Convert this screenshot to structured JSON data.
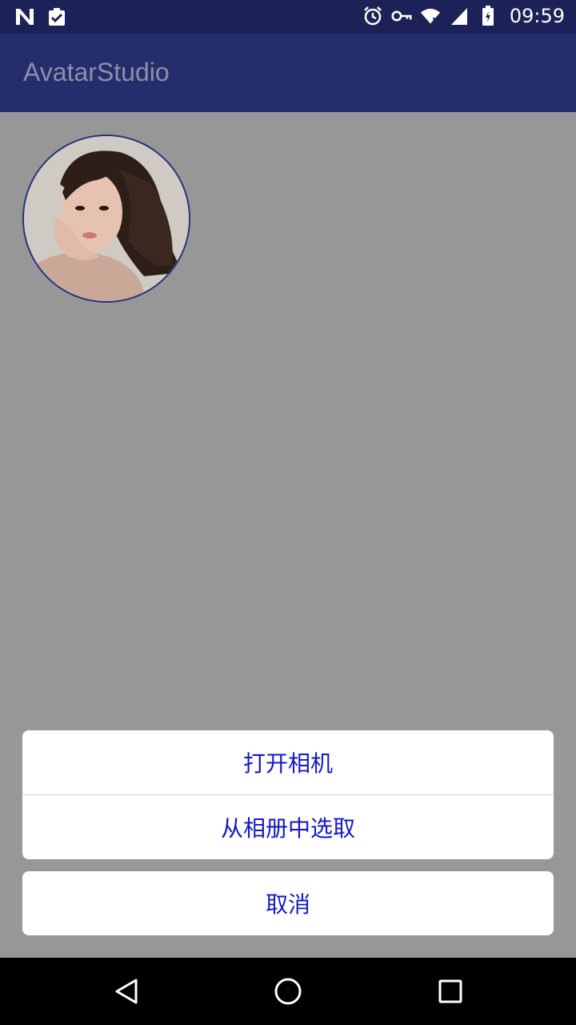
{
  "status_bar": {
    "time": "09:59",
    "icons": [
      "n-notification-icon",
      "clipboard-check-icon",
      "alarm-icon",
      "vpn-key-icon",
      "wifi-icon",
      "signal-icon",
      "battery-charging-icon"
    ]
  },
  "app_bar": {
    "title": "AvatarStudio"
  },
  "avatar": {
    "image": "portrait-avatar",
    "border_color": "#27307a"
  },
  "action_sheet": {
    "options": [
      "打开相机",
      "从相册中选取"
    ],
    "cancel_label": "取消",
    "text_color": "#1418c8"
  },
  "nav_bar": {
    "buttons": [
      "back-triangle-icon",
      "home-circle-icon",
      "recents-square-icon"
    ]
  },
  "colors": {
    "status_bar": "#1c2257",
    "app_bar": "#262d6d",
    "scrim_background": "#979797"
  }
}
